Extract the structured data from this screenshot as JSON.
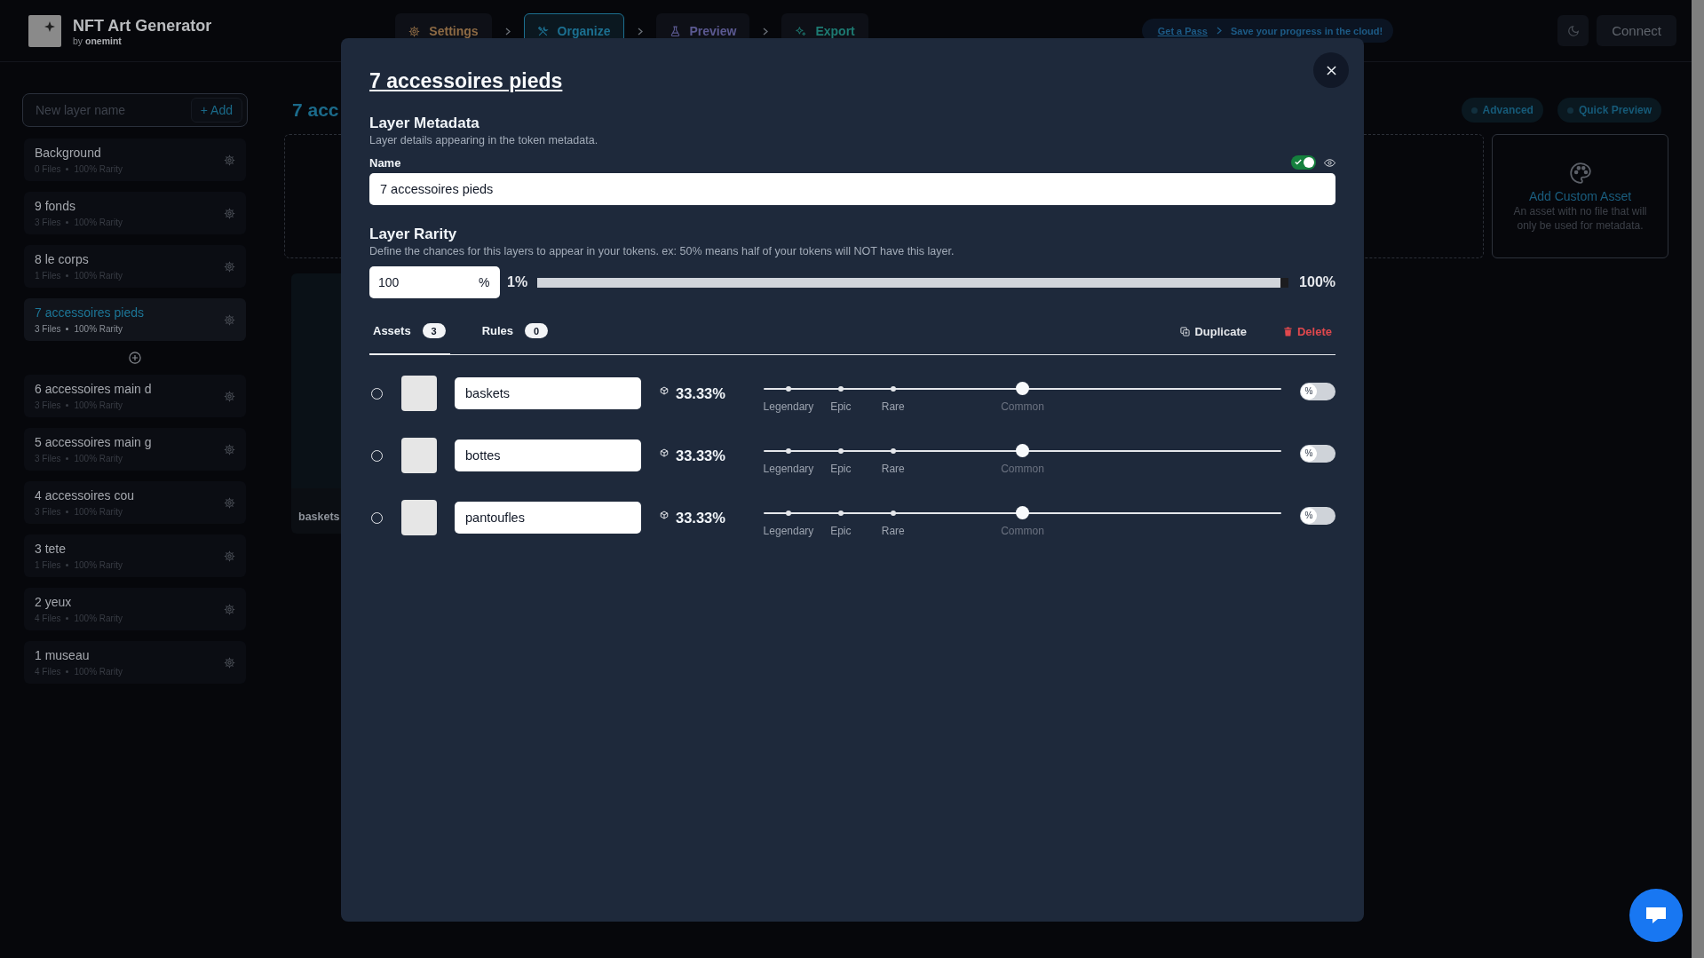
{
  "header": {
    "app_title": "NFT Art Generator",
    "byline": "by **onemint**",
    "steps": [
      {
        "kind": "settings",
        "label": "Settings",
        "selected": false
      },
      {
        "kind": "organize",
        "label": "Organize",
        "selected": true
      },
      {
        "kind": "preview",
        "label": "Preview",
        "selected": false
      },
      {
        "kind": "export",
        "label": "Export",
        "selected": false
      }
    ],
    "promo": {
      "link": "Get a Pass",
      "message": "Save your progress in the cloud!"
    },
    "connect_button": "Connect"
  },
  "sidebar": {
    "new_layer": {
      "placeholder": "New layer name",
      "add_button": "+ Add"
    },
    "layers": [
      {
        "name": "Background",
        "files": "0 Files",
        "rarity": "100% Rarity",
        "selected": false
      },
      {
        "name": "9 fonds",
        "files": "3 Files",
        "rarity": "100% Rarity",
        "selected": false
      },
      {
        "name": "8 le corps",
        "files": "1 Files",
        "rarity": "100% Rarity",
        "selected": false
      },
      {
        "name": "7 accessoires pieds",
        "files": "3 Files",
        "rarity": "100% Rarity",
        "selected": true
      },
      {
        "name": "6 accessoires main d",
        "files": "3 Files",
        "rarity": "100% Rarity",
        "selected": false
      },
      {
        "name": "5 accessoires main g",
        "files": "3 Files",
        "rarity": "100% Rarity",
        "selected": false
      },
      {
        "name": "4 accessoires cou",
        "files": "3 Files",
        "rarity": "100% Rarity",
        "selected": false
      },
      {
        "name": "3 tete",
        "files": "1 Files",
        "rarity": "100% Rarity",
        "selected": false
      },
      {
        "name": "2 yeux",
        "files": "4 Files",
        "rarity": "100% Rarity",
        "selected": false
      },
      {
        "name": "1 museau",
        "files": "4 Files",
        "rarity": "100% Rarity",
        "selected": false
      }
    ]
  },
  "main": {
    "title": "7 acc",
    "toggles": [
      {
        "label": "Advanced",
        "on": false
      },
      {
        "label": "Quick Preview",
        "on": false
      }
    ],
    "custom_asset": {
      "title": "Add Custom Asset",
      "description": "An asset with no file that will only be used for metadata."
    },
    "asset_cards": [
      {
        "name": "baskets"
      }
    ]
  },
  "modal": {
    "title": "7 accessoires pieds",
    "metadata": {
      "heading": "Layer Metadata",
      "description": "Layer details appearing in the token metadata.",
      "name_label": "Name",
      "name_value": "7 accessoires pieds",
      "toggle_on": true
    },
    "rarity": {
      "heading": "Layer Rarity",
      "description": "Define the chances for this layers to appear in your tokens. ex: 50% means half of your tokens will NOT have this layer.",
      "value": "100",
      "unit": "%",
      "min_label": "1%",
      "max_label": "100%",
      "level": 1
    },
    "tabs": [
      {
        "label": "Assets",
        "count": "3",
        "selected": true
      },
      {
        "label": "Rules",
        "count": "0",
        "selected": false
      }
    ],
    "actions": [
      {
        "kind": "duplicate",
        "label": "Duplicate"
      },
      {
        "kind": "delete",
        "label": "Delete"
      }
    ],
    "assets": [
      {
        "name": "baskets",
        "selected": false,
        "chance": "33.33%",
        "level": 0.5,
        "marks": [
          {
            "label": "Legendary",
            "selected": false
          },
          {
            "label": "Epic",
            "selected": false
          },
          {
            "label": "Rare",
            "selected": false
          },
          {
            "label": "Common",
            "selected": true
          }
        ],
        "toggle_label": "%",
        "percent_on": false
      },
      {
        "name": "bottes",
        "selected": false,
        "chance": "33.33%",
        "level": 0.5,
        "marks": [
          {
            "label": "Legendary",
            "selected": false
          },
          {
            "label": "Epic",
            "selected": false
          },
          {
            "label": "Rare",
            "selected": false
          },
          {
            "label": "Common",
            "selected": true
          }
        ],
        "toggle_label": "%",
        "percent_on": false
      },
      {
        "name": "pantoufles",
        "selected": false,
        "chance": "33.33%",
        "level": 0.5,
        "marks": [
          {
            "label": "Legendary",
            "selected": false
          },
          {
            "label": "Epic",
            "selected": false
          },
          {
            "label": "Rare",
            "selected": false
          },
          {
            "label": "Common",
            "selected": true
          }
        ],
        "toggle_label": "%",
        "percent_on": false
      }
    ]
  }
}
